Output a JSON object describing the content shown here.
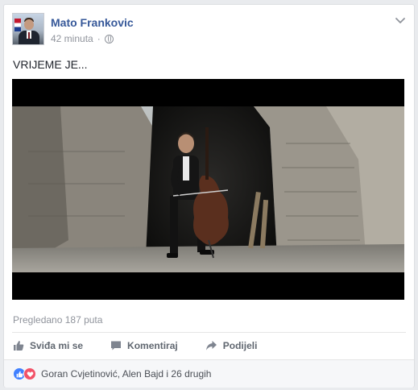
{
  "post": {
    "author": "Mato Frankovic",
    "time": "42 minuta",
    "separator": "·",
    "audience_icon": "globe-icon",
    "menu_icon": "chevron-down-icon",
    "text": "VRIJEME JE...",
    "video_icon": "video-frame",
    "views": "Pregledano 187 puta"
  },
  "actions": {
    "like": {
      "label": "Sviđa mi se",
      "icon": "thumbs-up-icon"
    },
    "comment": {
      "label": "Komentiraj",
      "icon": "comment-icon"
    },
    "share": {
      "label": "Podijeli",
      "icon": "share-icon"
    }
  },
  "reactions": {
    "icons": [
      "like-reaction-icon",
      "love-reaction-icon"
    ],
    "summary": "Goran Cvjetinović, Alen Bajd i 26 drugih"
  },
  "colors": {
    "link_blue": "#365899",
    "meta_gray": "#90949c",
    "action_gray": "#606770",
    "like_blue": "#4080ff",
    "love_red": "#f25268"
  }
}
